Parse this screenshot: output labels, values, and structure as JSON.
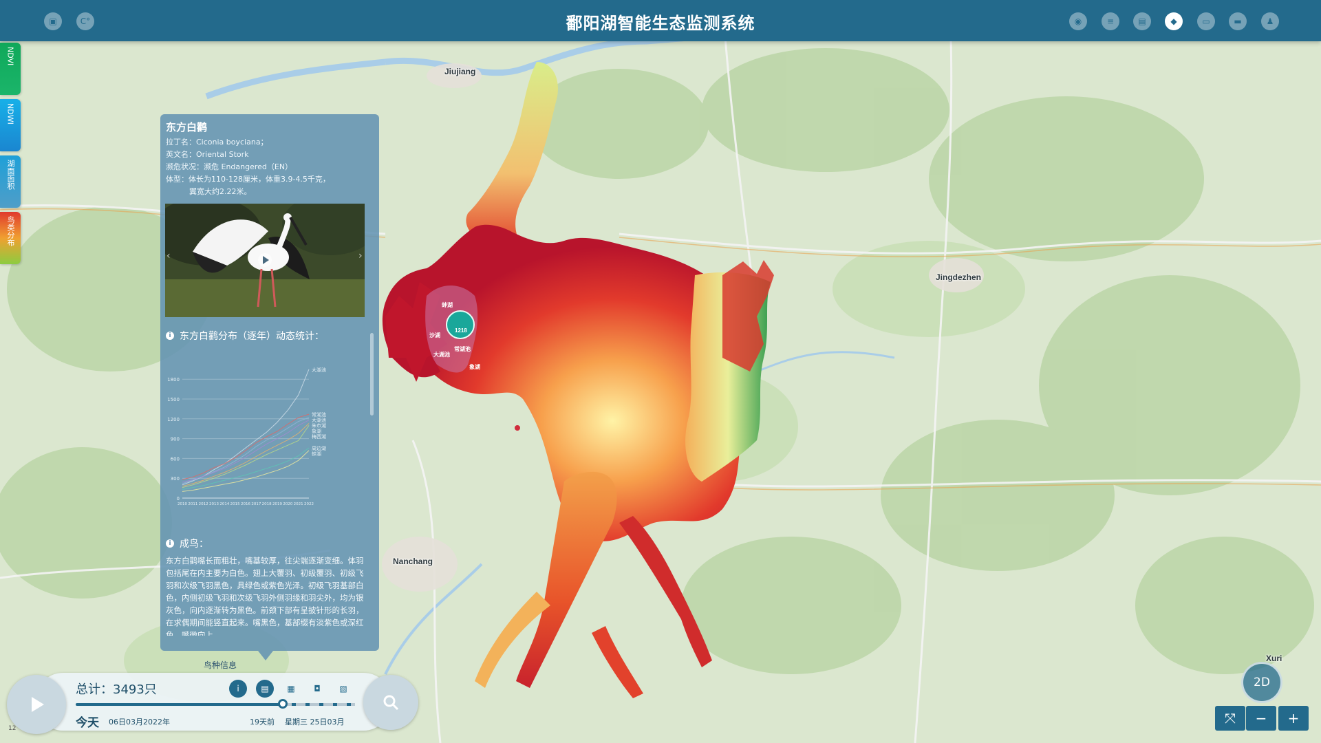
{
  "header": {
    "title": "鄱阳湖智能生态监测系统",
    "left_buttons": [
      {
        "icon": "document-icon",
        "glyph": "▣"
      },
      {
        "icon": "refresh-icon",
        "glyph": "C°"
      }
    ],
    "right_buttons": [
      {
        "icon": "location-icon",
        "glyph": "◉"
      },
      {
        "icon": "database-icon",
        "glyph": "≡"
      },
      {
        "icon": "report-icon",
        "glyph": "▤"
      },
      {
        "icon": "layers-icon",
        "glyph": "◆"
      },
      {
        "icon": "monitor-icon",
        "glyph": "▭"
      },
      {
        "icon": "message-icon",
        "glyph": "▬"
      },
      {
        "icon": "user-icon",
        "glyph": "♟"
      }
    ]
  },
  "side_tabs": [
    {
      "label": "NDVI",
      "color": "#16a05a"
    },
    {
      "label": "NDWI",
      "color": "#1aa0e0"
    },
    {
      "label": "湖面面积",
      "color": "#3a8ec2"
    },
    {
      "label": "鸟类分布",
      "color": "#d8402e"
    }
  ],
  "species": {
    "name": "东方白鹳",
    "latin": "拉丁名：Ciconia boyciana；",
    "english": "英文名：Oriental Stork",
    "status": "濒危状况：濒危 Endangered（EN）",
    "size": "体型：体长为110-128厘米，体重3.9-4.5千克，",
    "wingspan": "翼宽大约2.22米。",
    "chart_title": "东方白鹳分布（逐年）动态统计：",
    "adult_title": "成鸟：",
    "adult_text": "东方白鹳嘴长而粗壮，嘴基较厚，往尖端逐渐变细。体羽包括尾在内主要为白色。翅上大覆羽、初级覆羽、初级飞羽和次级飞羽黑色，具绿色或紫色光泽。初级飞羽基部白色，内侧初级飞羽和次级飞羽外侧羽缘和羽尖外，均为银灰色，向内逐渐转为黑色。前颈下部有呈披针形的长羽，在求偶期间能竖直起来。嘴黑色，基部缀有淡紫色或深红色，嘴微向上"
  },
  "chart_data": {
    "type": "line",
    "x": [
      2010,
      2011,
      2012,
      2013,
      2014,
      2015,
      2016,
      2017,
      2018,
      2019,
      2020,
      2021,
      2022
    ],
    "x_tick_labels": [
      "2010",
      "2011",
      "2012",
      "2013",
      "2014",
      "2015",
      "2016",
      "2017",
      "2018",
      "2019",
      "2020",
      "2021",
      "2022"
    ],
    "y_ticks": [
      0,
      300,
      600,
      900,
      1200,
      1500,
      1800
    ],
    "ylim": [
      0,
      2000
    ],
    "grid": true,
    "legend_placement": "right",
    "series": [
      {
        "name": "大湖池",
        "color": "#c9d9e6",
        "values": [
          200,
          260,
          330,
          430,
          520,
          640,
          760,
          880,
          1000,
          1150,
          1330,
          1560,
          1950
        ]
      },
      {
        "name": "常湖池",
        "color": "#d86a6a",
        "values": [
          280,
          320,
          380,
          460,
          520,
          610,
          720,
          840,
          930,
          1010,
          1120,
          1220,
          1270
        ]
      },
      {
        "name": "大湖池",
        "color": "#8fb4d6",
        "values": [
          220,
          270,
          330,
          400,
          470,
          560,
          660,
          780,
          880,
          960,
          1060,
          1160,
          1220
        ]
      },
      {
        "name": "朱市湖",
        "color": "#a18ad0",
        "values": [
          240,
          280,
          330,
          390,
          450,
          530,
          620,
          720,
          820,
          900,
          990,
          1100,
          1180
        ]
      },
      {
        "name": "象湖",
        "color": "#e0b070",
        "values": [
          180,
          220,
          270,
          330,
          390,
          460,
          540,
          630,
          720,
          800,
          880,
          980,
          1130
        ]
      },
      {
        "name": "梅西湖",
        "color": "#b7d78a",
        "values": [
          160,
          200,
          250,
          300,
          360,
          430,
          500,
          580,
          660,
          730,
          800,
          870,
          1100
        ]
      },
      {
        "name": "周边湖",
        "color": "#5fc3b5",
        "values": [
          130,
          160,
          190,
          230,
          270,
          310,
          350,
          400,
          450,
          500,
          560,
          640,
          760
        ]
      },
      {
        "name": "蚌湖",
        "color": "#e6e6a0",
        "values": [
          100,
          120,
          150,
          180,
          210,
          240,
          280,
          320,
          370,
          420,
          480,
          570,
          720
        ]
      }
    ]
  },
  "map": {
    "cities": [
      {
        "name": "Jiujiang"
      },
      {
        "name": "Jingdezhen"
      },
      {
        "name": "Nanchang"
      },
      {
        "name": "Xuri"
      }
    ],
    "markers": [
      {
        "label": "蚌湖"
      },
      {
        "label": "沙湖"
      },
      {
        "label": "大湖池"
      },
      {
        "label": "常湖池"
      },
      {
        "label": "象湖"
      },
      {
        "label": "1218"
      }
    ]
  },
  "timeline": {
    "total": "总计：3493只",
    "today": "今天",
    "start_date": "06日03月2022年",
    "days_ago": "19天前",
    "current_date": "星期三 25日03月",
    "bird_info_label": "鸟种信息",
    "tools": [
      {
        "icon": "info-icon",
        "glyph": "i"
      },
      {
        "icon": "list-icon",
        "glyph": "▤"
      },
      {
        "icon": "table-icon",
        "glyph": "▦"
      },
      {
        "icon": "chart-icon",
        "glyph": "◘"
      },
      {
        "icon": "note-icon",
        "glyph": "▧"
      }
    ]
  },
  "controls": {
    "view_mode": "2D",
    "fullscreen_glyph": "⤧",
    "zoom_out_glyph": "−",
    "zoom_in_glyph": "+",
    "scale": "12"
  },
  "colors": {
    "header": "#236a8c",
    "accent": "#236a8c",
    "panel": "#6292b2"
  }
}
